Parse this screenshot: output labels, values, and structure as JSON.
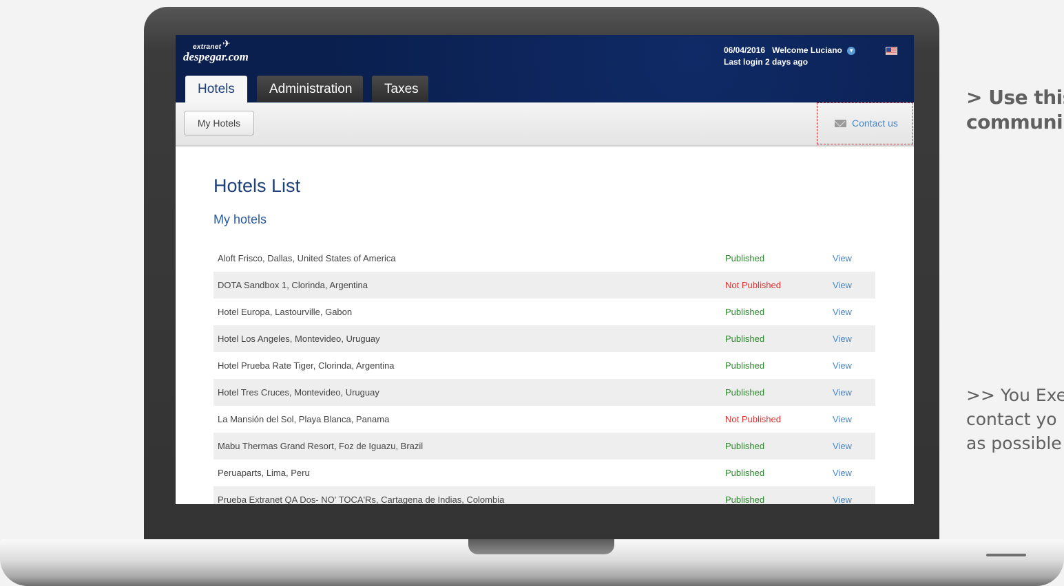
{
  "header": {
    "logo_small": "extranet",
    "logo_main": "despegar.com",
    "date": "06/04/2016",
    "welcome": "Welcome Luciano",
    "last_login": "Last login 2 days ago"
  },
  "tabs": [
    {
      "label": "Hotels",
      "active": true
    },
    {
      "label": "Administration",
      "active": false
    },
    {
      "label": "Taxes",
      "active": false
    }
  ],
  "subbar": {
    "my_hotels": "My Hotels",
    "contact_us": "Contact us"
  },
  "main": {
    "title": "Hotels List",
    "section": "My hotels",
    "view_label": "View",
    "hotels": [
      {
        "name": "Aloft Frisco, Dallas, United States of America",
        "status": "Published"
      },
      {
        "name": "DOTA Sandbox 1, Clorinda, Argentina",
        "status": "Not Published"
      },
      {
        "name": "Hotel Europa, Lastourville, Gabon",
        "status": "Published"
      },
      {
        "name": "Hotel Los Angeles, Montevideo, Uruguay",
        "status": "Published"
      },
      {
        "name": "Hotel Prueba Rate Tiger, Clorinda, Argentina",
        "status": "Published"
      },
      {
        "name": "Hotel Tres Cruces, Montevideo, Uruguay",
        "status": "Published"
      },
      {
        "name": "La Mansión del Sol, Playa Blanca, Panama",
        "status": "Not Published"
      },
      {
        "name": "Mabu Thermas Grand Resort, Foz de Iguazu, Brazil",
        "status": "Published"
      },
      {
        "name": "Peruaparts, Lima, Peru",
        "status": "Published"
      },
      {
        "name": "Prueba Extranet QA Dos- NO' TOCA'Rs, Cartagena de Indias, Colombia",
        "status": "Published"
      }
    ]
  },
  "annotations": {
    "top_line1": "> Use this",
    "top_line2": "communi",
    "bottom_line1": ">> You Exe",
    "bottom_line2": "contact yo",
    "bottom_line3": "as possible"
  },
  "colors": {
    "header_bg": "#0a1f4e",
    "published": "#2d8a2d",
    "not_published": "#e03030",
    "link": "#4b86c5",
    "title": "#1d3f7a"
  }
}
